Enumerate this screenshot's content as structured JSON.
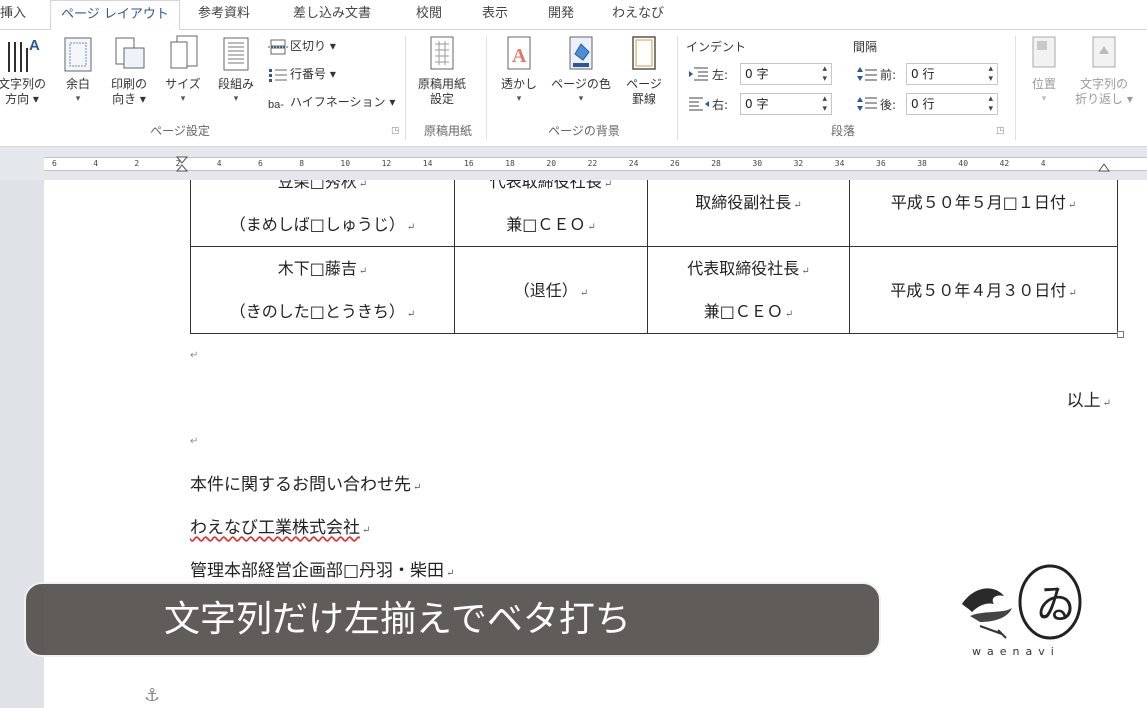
{
  "ribbon_tabs": [
    "挿入",
    "ページ レイアウト",
    "参考資料",
    "差し込み文書",
    "校閲",
    "表示",
    "開発",
    "わえなび"
  ],
  "page_setup": {
    "text_direction": [
      "文字列の",
      "方向 ▾"
    ],
    "margins": "余白",
    "orientation": [
      "印刷の",
      "向き ▾"
    ],
    "size": "サイズ",
    "columns": "段組み",
    "breaks": "区切り ▾",
    "line_numbers": "行番号 ▾",
    "hyphenation": "ハイフネーション ▾",
    "group_label": "ページ設定"
  },
  "manuscript": {
    "settings": [
      "原稿用紙",
      "設定"
    ],
    "group_label": "原稿用紙"
  },
  "background": {
    "watermark": "透かし",
    "page_color": "ページの色",
    "page_borders": [
      "ページ",
      "罫線"
    ],
    "group_label": "ページの背景"
  },
  "paragraph": {
    "indent_header": "インデント",
    "spacing_header": "間隔",
    "left_label": "左:",
    "left_value": "0 字",
    "right_label": "右:",
    "right_value": "0 字",
    "before_label": "前:",
    "before_value": "0 行",
    "after_label": "後:",
    "after_value": "0 行",
    "group_label": "段落"
  },
  "arrange": {
    "position": "位置",
    "wrap_text": [
      "文字列の",
      "折り返し ▾"
    ]
  },
  "ruler_numbers": [
    "6",
    "4",
    "2",
    "2",
    "4",
    "6",
    "8",
    "10",
    "12",
    "14",
    "16",
    "18",
    "20",
    "22",
    "24",
    "26",
    "28",
    "30",
    "32",
    "34",
    "36",
    "38",
    "40",
    "42",
    "4"
  ],
  "document": {
    "table_rows": [
      {
        "name": [
          "豆柴□秀秋",
          "（まめしば□しゅうじ）"
        ],
        "old_title": [
          "代表取締役社長",
          "兼□ＣＥＯ"
        ],
        "new_title": [
          "取締役副社長"
        ],
        "date": "平成５０年５月□１日付"
      },
      {
        "name": [
          "木下□藤吉",
          "（きのした□とうきち）"
        ],
        "old_title": [
          "（退任）"
        ],
        "new_title": [
          "代表取締役社長",
          "兼□ＣＥＯ"
        ],
        "date": "平成５０年４月３０日付"
      }
    ],
    "closing": "以上",
    "contact_heading": "本件に関するお問い合わせ先",
    "company": "わえなび工業株式会社",
    "department": "管理本部経営企画部□丹羽・柴田"
  },
  "caption": "文字列だけ左揃えでベタ打ち",
  "logo_text": "waenavi",
  "colors": {
    "accent": "#2b579a",
    "caption_bg": "#54504c",
    "squiggle": "#d33333"
  }
}
